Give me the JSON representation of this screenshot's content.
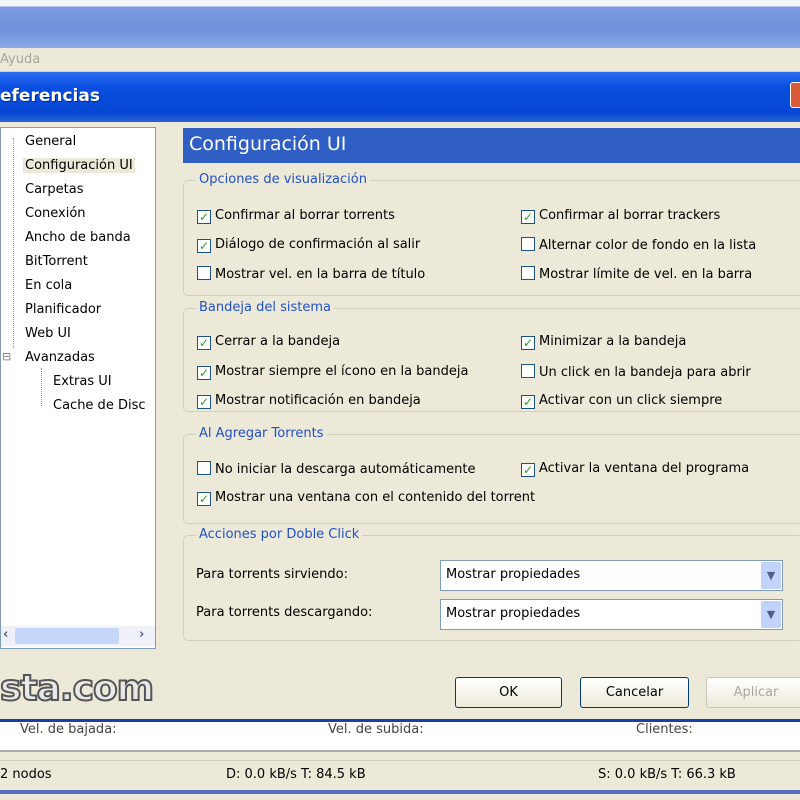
{
  "menu": {
    "help": "Ayuda"
  },
  "dialog": {
    "title": "eferencias"
  },
  "tree": {
    "items": [
      "General",
      "Configuración UI",
      "Carpetas",
      "Conexión",
      "Ancho de banda",
      "BitTorrent",
      "En cola",
      "Planificador",
      "Web UI",
      "Avanzadas"
    ],
    "children": [
      "Extras UI",
      "Cache de Disc"
    ],
    "expander": "⊟"
  },
  "panel": {
    "title": "Configuración UI"
  },
  "groups": {
    "display": {
      "legend": "Opciones de visualización",
      "items": [
        {
          "label": "Confirmar al borrar torrents",
          "checked": true
        },
        {
          "label": "Confirmar al borrar trackers",
          "checked": true
        },
        {
          "label": "Diálogo de confirmación al salir",
          "checked": true
        },
        {
          "label": "Alternar color de fondo en la lista",
          "checked": false
        },
        {
          "label": "Mostrar vel. en la barra de título",
          "checked": false
        },
        {
          "label": "Mostrar límite de vel. en la barra",
          "checked": false
        }
      ]
    },
    "tray": {
      "legend": "Bandeja del sistema",
      "items": [
        {
          "label": "Cerrar a la bandeja",
          "checked": true
        },
        {
          "label": "Minimizar a la bandeja",
          "checked": true
        },
        {
          "label": "Mostrar siempre el ícono en la bandeja",
          "checked": true
        },
        {
          "label": "Un click en la bandeja para abrir",
          "checked": false
        },
        {
          "label": "Mostrar notificación en bandeja",
          "checked": true
        },
        {
          "label": "Activar con un click siempre",
          "checked": true
        }
      ]
    },
    "add": {
      "legend": "Al Agregar Torrents",
      "items": [
        {
          "label": "No iniciar la descarga automáticamente",
          "checked": false
        },
        {
          "label": "Activar la ventana del programa",
          "checked": true
        },
        {
          "label": "Mostrar una ventana con el contenido del torrent",
          "checked": true
        }
      ]
    },
    "dbl": {
      "legend": "Acciones por Doble Click",
      "seeding_label": "Para torrents sirviendo:",
      "seeding_value": "Mostrar propiedades",
      "downloading_label": "Para torrents descargando:",
      "downloading_value": "Mostrar propiedades"
    }
  },
  "buttons": {
    "ok": "OK",
    "cancel": "Cancelar",
    "apply": "Aplicar"
  },
  "watermark": "sta.com",
  "lower": {
    "down": "Vel. de bajada:",
    "up": "Vel. de subida:",
    "clients": "Clientes:"
  },
  "status": {
    "nodes": "2 nodos",
    "download": "D: 0.0 kB/s T: 84.5 kB",
    "upload": "S: 0.0 kB/s T: 66.3 kB"
  }
}
